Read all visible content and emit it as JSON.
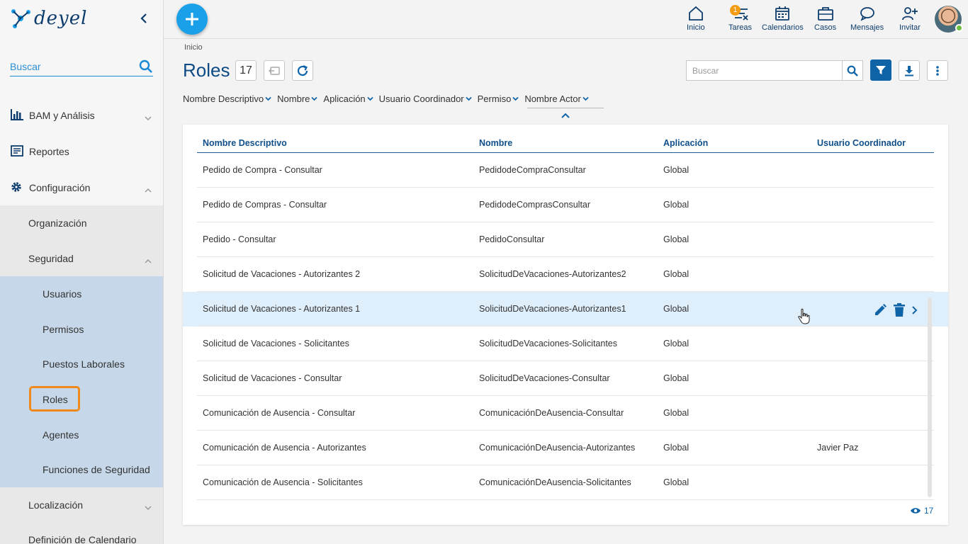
{
  "app": {
    "logo_text": "deyel"
  },
  "sidebar": {
    "search_placeholder": "Buscar",
    "items": [
      {
        "label": "BAM y Análisis"
      },
      {
        "label": "Reportes"
      },
      {
        "label": "Configuración"
      }
    ],
    "config_items": [
      {
        "label": "Organización"
      },
      {
        "label": "Seguridad"
      }
    ],
    "security_items": [
      {
        "label": "Usuarios"
      },
      {
        "label": "Permisos"
      },
      {
        "label": "Puestos Laborales"
      },
      {
        "label": "Roles"
      },
      {
        "label": "Agentes"
      },
      {
        "label": "Funciones de Seguridad"
      }
    ],
    "after_items": [
      {
        "label": "Localización"
      },
      {
        "label": "Definición de Calendario"
      }
    ]
  },
  "topbar": {
    "items": [
      {
        "label": "Inicio",
        "icon": "home-icon"
      },
      {
        "label": "Tareas",
        "icon": "tasks-icon",
        "badge": "1"
      },
      {
        "label": "Calendarios",
        "icon": "calendar-icon"
      },
      {
        "label": "Casos",
        "icon": "briefcase-icon"
      },
      {
        "label": "Mensajes",
        "icon": "chat-icon"
      },
      {
        "label": "Invitar",
        "icon": "invite-user-icon"
      }
    ]
  },
  "page": {
    "breadcrumb": "Inicio",
    "title": "Roles",
    "count": "17",
    "search_placeholder": "Buscar",
    "column_selectors": [
      "Nombre Descriptivo",
      "Nombre",
      "Aplicación",
      "Usuario Coordinador",
      "Permiso",
      "Nombre Actor"
    ]
  },
  "table": {
    "headers": [
      "Nombre Descriptivo",
      "Nombre",
      "Aplicación",
      "Usuario Coordinador"
    ],
    "rows": [
      [
        "Pedido de Compra - Consultar",
        "PedidodeCompraConsultar",
        "Global",
        ""
      ],
      [
        "Pedido de Compras - Consultar",
        "PedidodeComprasConsultar",
        "Global",
        ""
      ],
      [
        "Pedido - Consultar",
        "PedidoConsultar",
        "Global",
        ""
      ],
      [
        "Solicitud de Vacaciones - Autorizantes 2",
        "SolicitudDeVacaciones-Autorizantes2",
        "Global",
        ""
      ],
      [
        "Solicitud de Vacaciones - Autorizantes 1",
        "SolicitudDeVacaciones-Autorizantes1",
        "Global",
        ""
      ],
      [
        "Solicitud de Vacaciones - Solicitantes",
        "SolicitudDeVacaciones-Solicitantes",
        "Global",
        ""
      ],
      [
        "Solicitud de Vacaciones - Consultar",
        "SolicitudDeVacaciones-Consultar",
        "Global",
        ""
      ],
      [
        "Comunicación de Ausencia - Consultar",
        "ComunicaciónDeAusencia-Consultar",
        "Global",
        ""
      ],
      [
        "Comunicación de Ausencia - Autorizantes",
        "ComunicaciónDeAusencia-Autorizantes",
        "Global",
        "Javier Paz"
      ],
      [
        "Comunicación de Ausencia - Solicitantes",
        "ComunicaciónDeAusencia-Solicitantes",
        "Global",
        ""
      ]
    ],
    "active_row": 4,
    "view_count": "17"
  },
  "colors": {
    "primary": "#0f64a8",
    "accent": "#1aa0e8",
    "highlight": "#f08a1c",
    "active_row": "#dfeefb"
  }
}
